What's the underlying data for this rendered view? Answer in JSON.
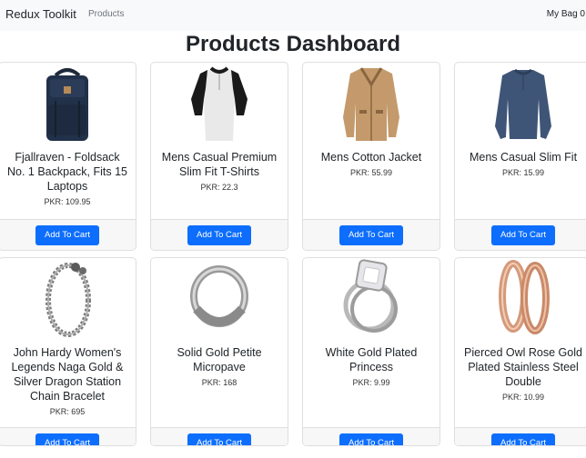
{
  "navbar": {
    "brand": "Redux Toolkit",
    "link": "Products",
    "bag": "My Bag 0"
  },
  "page": {
    "title": "Products Dashboard"
  },
  "add_to_cart_label": "Add To Cart",
  "products": [
    {
      "title": "Fjallraven - Foldsack No. 1 Backpack, Fits 15 Laptops",
      "price": "PKR: 109.95",
      "icon": "backpack-icon"
    },
    {
      "title": "Mens Casual Premium Slim Fit T-Shirts",
      "price": "PKR: 22.3",
      "icon": "tshirt-icon"
    },
    {
      "title": "Mens Cotton Jacket",
      "price": "PKR: 55.99",
      "icon": "jacket-icon"
    },
    {
      "title": "Mens Casual Slim Fit",
      "price": "PKR: 15.99",
      "icon": "sweater-icon"
    },
    {
      "title": "John Hardy Women's Legends Naga Gold & Silver Dragon Station Chain Bracelet",
      "price": "PKR: 695",
      "icon": "bracelet-icon"
    },
    {
      "title": "Solid Gold Petite Micropave",
      "price": "PKR: 168",
      "icon": "ring-icon"
    },
    {
      "title": "White Gold Plated Princess",
      "price": "PKR: 9.99",
      "icon": "diamond-ring-icon"
    },
    {
      "title": "Pierced Owl Rose Gold Plated Stainless Steel Double",
      "price": "PKR: 10.99",
      "icon": "earrings-icon"
    }
  ]
}
